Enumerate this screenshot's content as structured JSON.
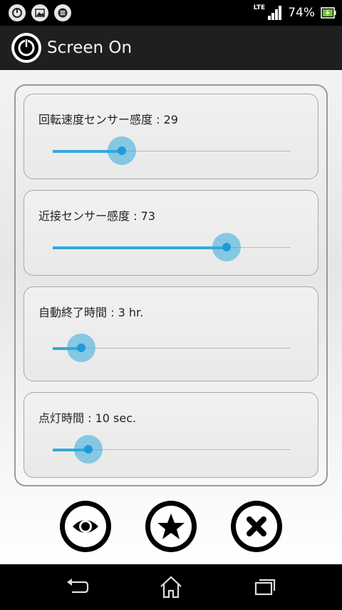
{
  "status_bar": {
    "network": "LTE",
    "battery_percent": "74%",
    "left_icons": [
      "power-notification-icon",
      "image-notification-icon",
      "list-notification-icon"
    ]
  },
  "app_bar": {
    "title": "Screen On",
    "icon": "power-icon"
  },
  "settings": [
    {
      "label": "回転速度センサー感度 : 29",
      "value_fraction": 0.29
    },
    {
      "label": "近接センサー感度 : 73",
      "value_fraction": 0.73
    },
    {
      "label": "自動終了時間 : 3 hr.",
      "value_fraction": 0.12
    },
    {
      "label": "点灯時間 : 10 sec.",
      "value_fraction": 0.15
    }
  ],
  "actions": [
    {
      "icon": "eye-icon"
    },
    {
      "icon": "star-icon"
    },
    {
      "icon": "close-icon"
    }
  ],
  "nav": [
    "back-icon",
    "home-icon",
    "recents-icon"
  ],
  "colors": {
    "accent": "#33a9dd",
    "app_bar": "#1f1f1f"
  }
}
